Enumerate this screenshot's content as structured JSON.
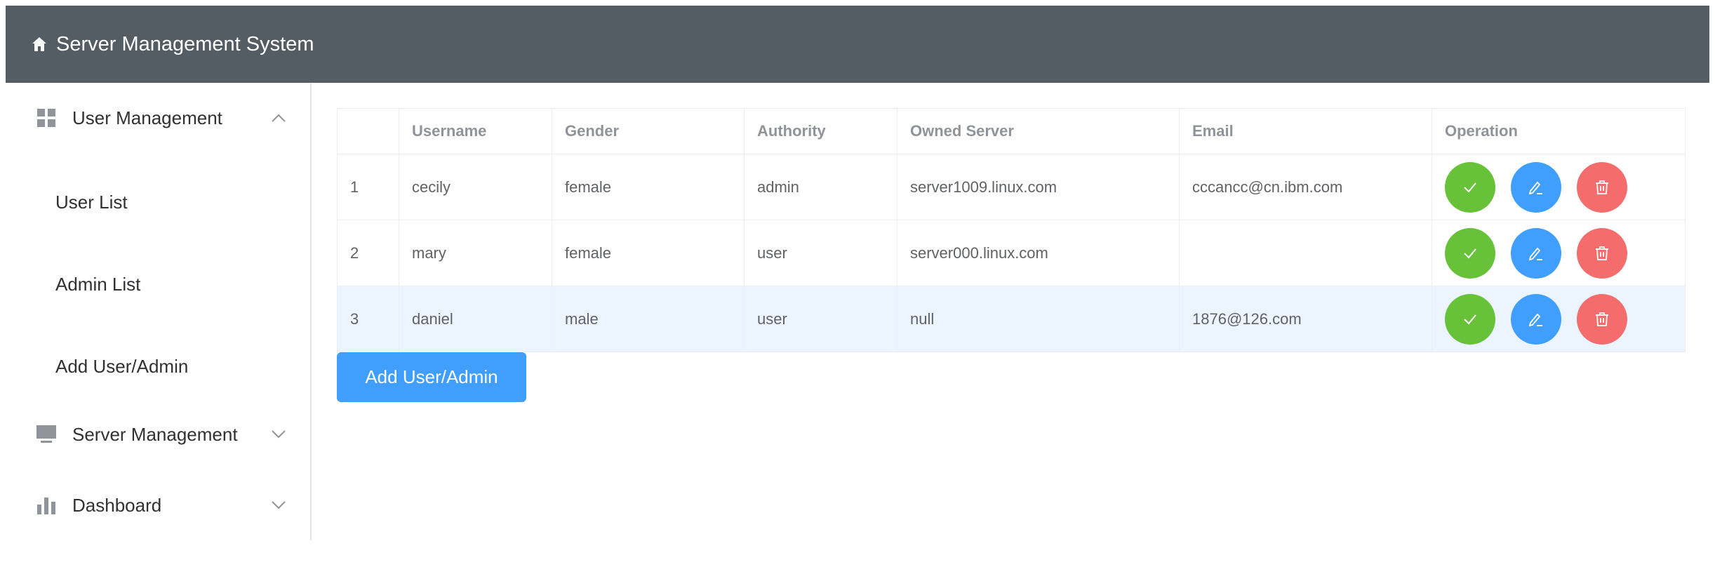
{
  "header": {
    "title": "Server Management System",
    "icon": "home-icon"
  },
  "sidebar": {
    "menus": [
      {
        "label": "User Management",
        "icon": "grid-icon",
        "expanded": true,
        "items": [
          "User List",
          "Admin List",
          "Add User/Admin"
        ]
      },
      {
        "label": "Server Management",
        "icon": "monitor-icon",
        "expanded": false
      },
      {
        "label": "Dashboard",
        "icon": "bar-chart-icon",
        "expanded": false
      }
    ]
  },
  "table": {
    "columns": [
      "",
      "Username",
      "Gender",
      "Authority",
      "Owned Server",
      "Email",
      "Operation"
    ],
    "rows": [
      {
        "index": "1",
        "username": "cecily",
        "gender": "female",
        "authority": "admin",
        "server": "server1009.linux.com",
        "email": "cccancc@cn.ibm.com"
      },
      {
        "index": "2",
        "username": "mary",
        "gender": "female",
        "authority": "user",
        "server": "server000.linux.com",
        "email": ""
      },
      {
        "index": "3",
        "username": "daniel",
        "gender": "male",
        "authority": "user",
        "server": "null",
        "email": "1876@126.com"
      }
    ],
    "highlighted_row": 3,
    "operations": [
      "check-icon",
      "edit-icon",
      "delete-icon"
    ]
  },
  "add_button": {
    "label": "Add User/Admin"
  },
  "colors": {
    "header_bg": "#545c64",
    "primary": "#409eff",
    "success": "#67c23a",
    "danger": "#f56c6c",
    "row_highlight": "#ecf5ff"
  }
}
